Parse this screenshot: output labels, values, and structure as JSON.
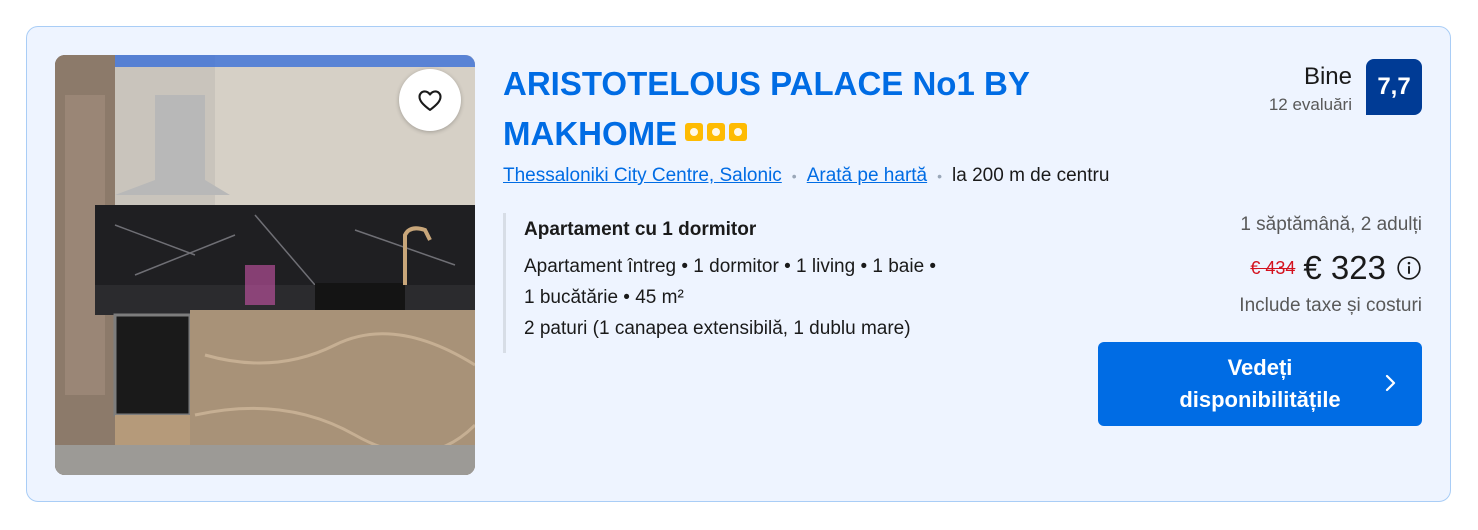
{
  "listing": {
    "title": "ARISTOTELOUS PALACE No1 BY MAKHOME",
    "star_count": 3,
    "location_link": "Thessaloniki City Centre, Salonic",
    "map_link": "Arată pe hartă",
    "distance": "la 200 m de centru",
    "unit": {
      "name": "Apartament cu 1 dormitor",
      "description_line1": "Apartament întreg • 1 dormitor • 1 living • 1 baie •",
      "description_line2": "1 bucătărie • 45 m²",
      "beds": "2 paturi (1 canapea extensibilă, 1 dublu mare)"
    },
    "rating": {
      "word": "Bine",
      "count": "12 evaluări",
      "score": "7,7"
    },
    "price": {
      "stay_info": "1 săptămână, 2 adulți",
      "old": "€ 434",
      "current": "€ 323",
      "tax_note": "Include taxe și costuri"
    },
    "cta_label": "Vedeți disponibilitățile"
  },
  "icons": {
    "favorite": "heart-icon",
    "info": "info-icon",
    "chevron": "chevron-right-icon"
  },
  "colors": {
    "link": "#006ce4",
    "badge": "#003b95",
    "old_price": "#d4111e",
    "star": "#febb02",
    "card_bg": "#eef4ff"
  }
}
